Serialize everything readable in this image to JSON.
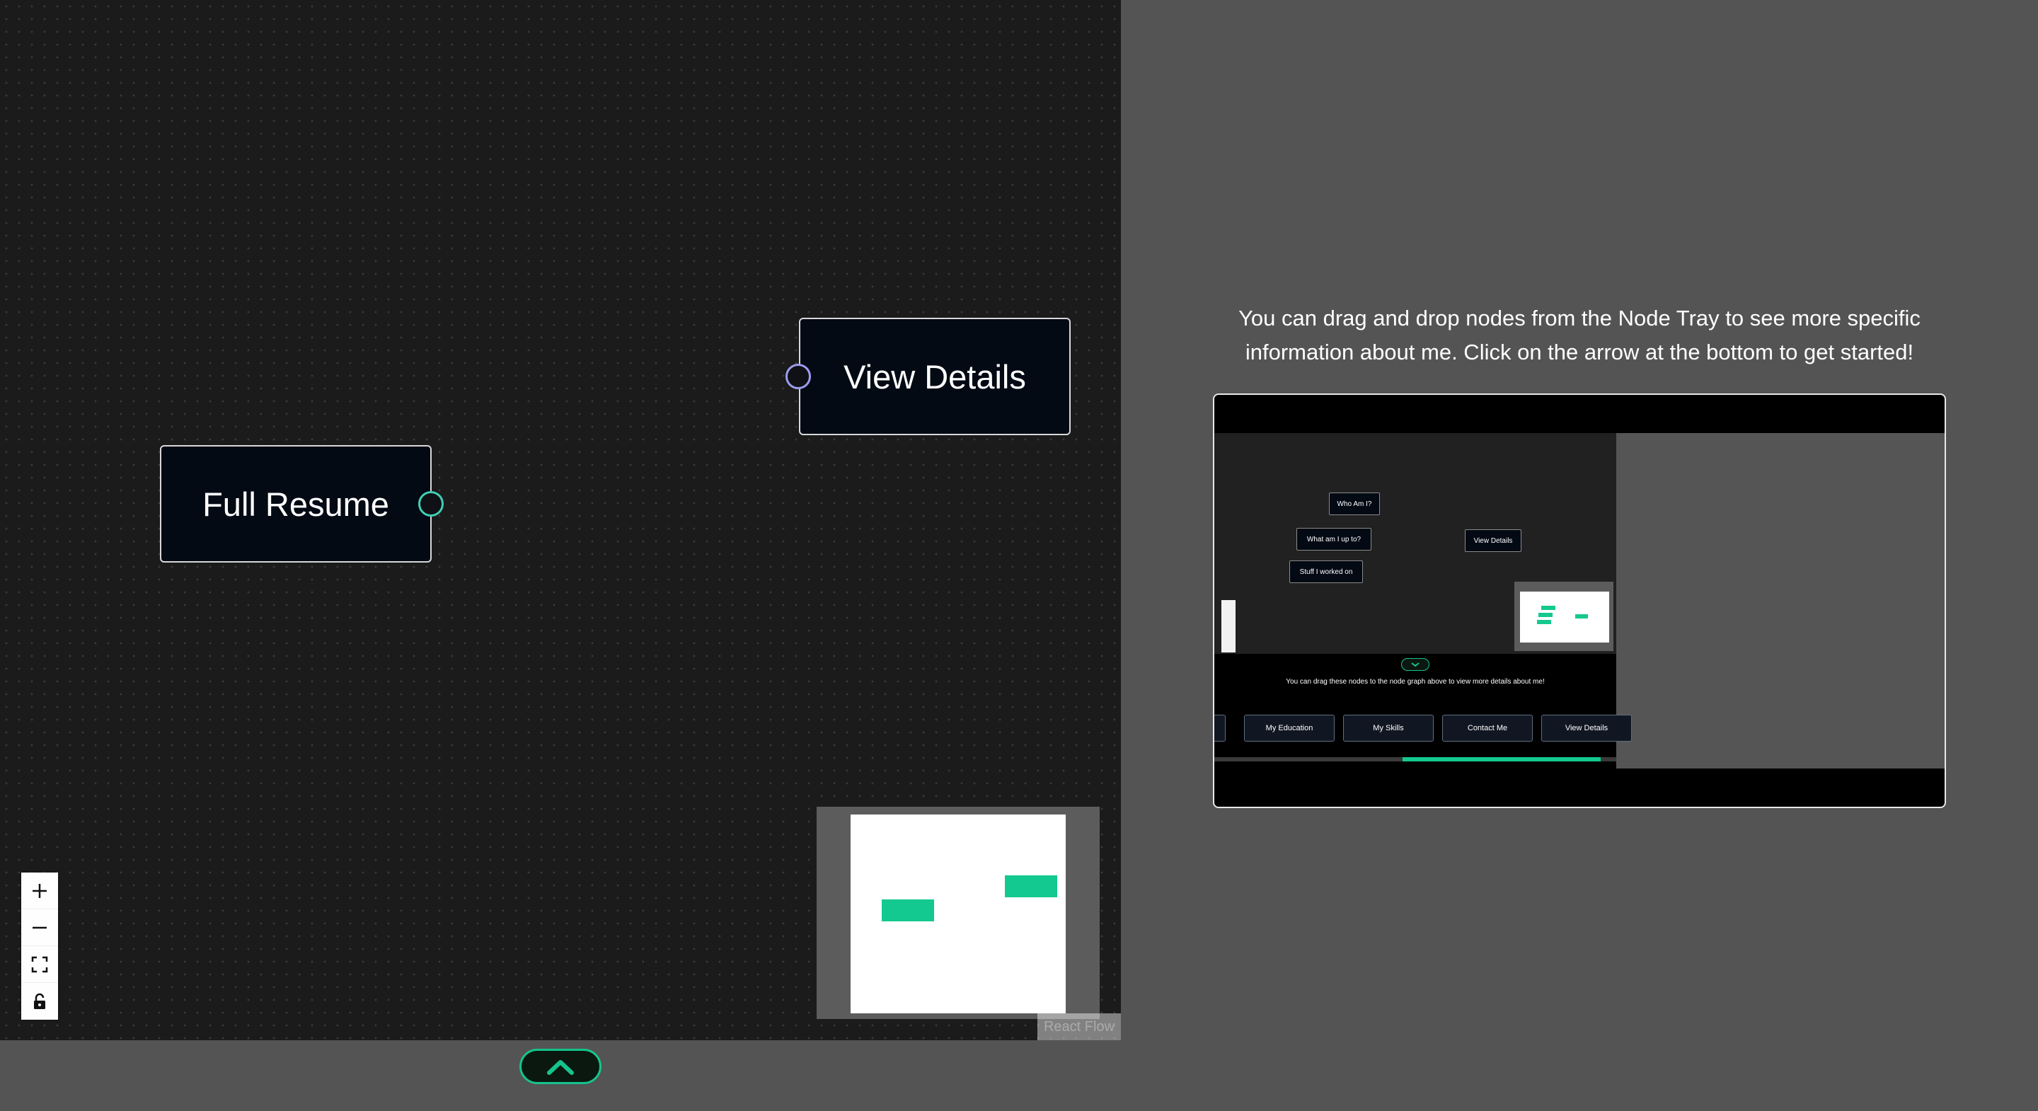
{
  "canvas": {
    "nodes": [
      {
        "label": "Full Resume",
        "handle": "source",
        "handle_color": "#3fd0b4"
      },
      {
        "label": "View Details",
        "handle": "target",
        "handle_color": "#9c9cf0"
      }
    ],
    "controls": [
      {
        "name": "zoom-in",
        "icon": "plus-icon"
      },
      {
        "name": "zoom-out",
        "icon": "minus-icon"
      },
      {
        "name": "fit-view",
        "icon": "fit-view-icon"
      },
      {
        "name": "toggle-interactivity",
        "icon": "lock-icon"
      }
    ],
    "attribution": "React Flow",
    "minimap_node_color": "#13c98f"
  },
  "tray_toggle": {
    "icon": "chevron-up-icon",
    "accent": "#15c48c"
  },
  "info": {
    "text": "You can drag and drop nodes from the Node Tray to see more specific information about me. Click on the arrow at the bottom to get started!"
  },
  "demo": {
    "nodes": [
      "Who Am I?",
      "What am I up to?",
      "Stuff I worked on",
      "View Details"
    ],
    "tray_text": "You can drag these nodes to the node graph above to view more details about me!",
    "tray_buttons": [
      "My Education",
      "My Skills",
      "Contact Me",
      "View Details"
    ]
  },
  "colors": {
    "background": "#545454",
    "canvas": "#1b1b1b",
    "accent": "#13c98f"
  }
}
